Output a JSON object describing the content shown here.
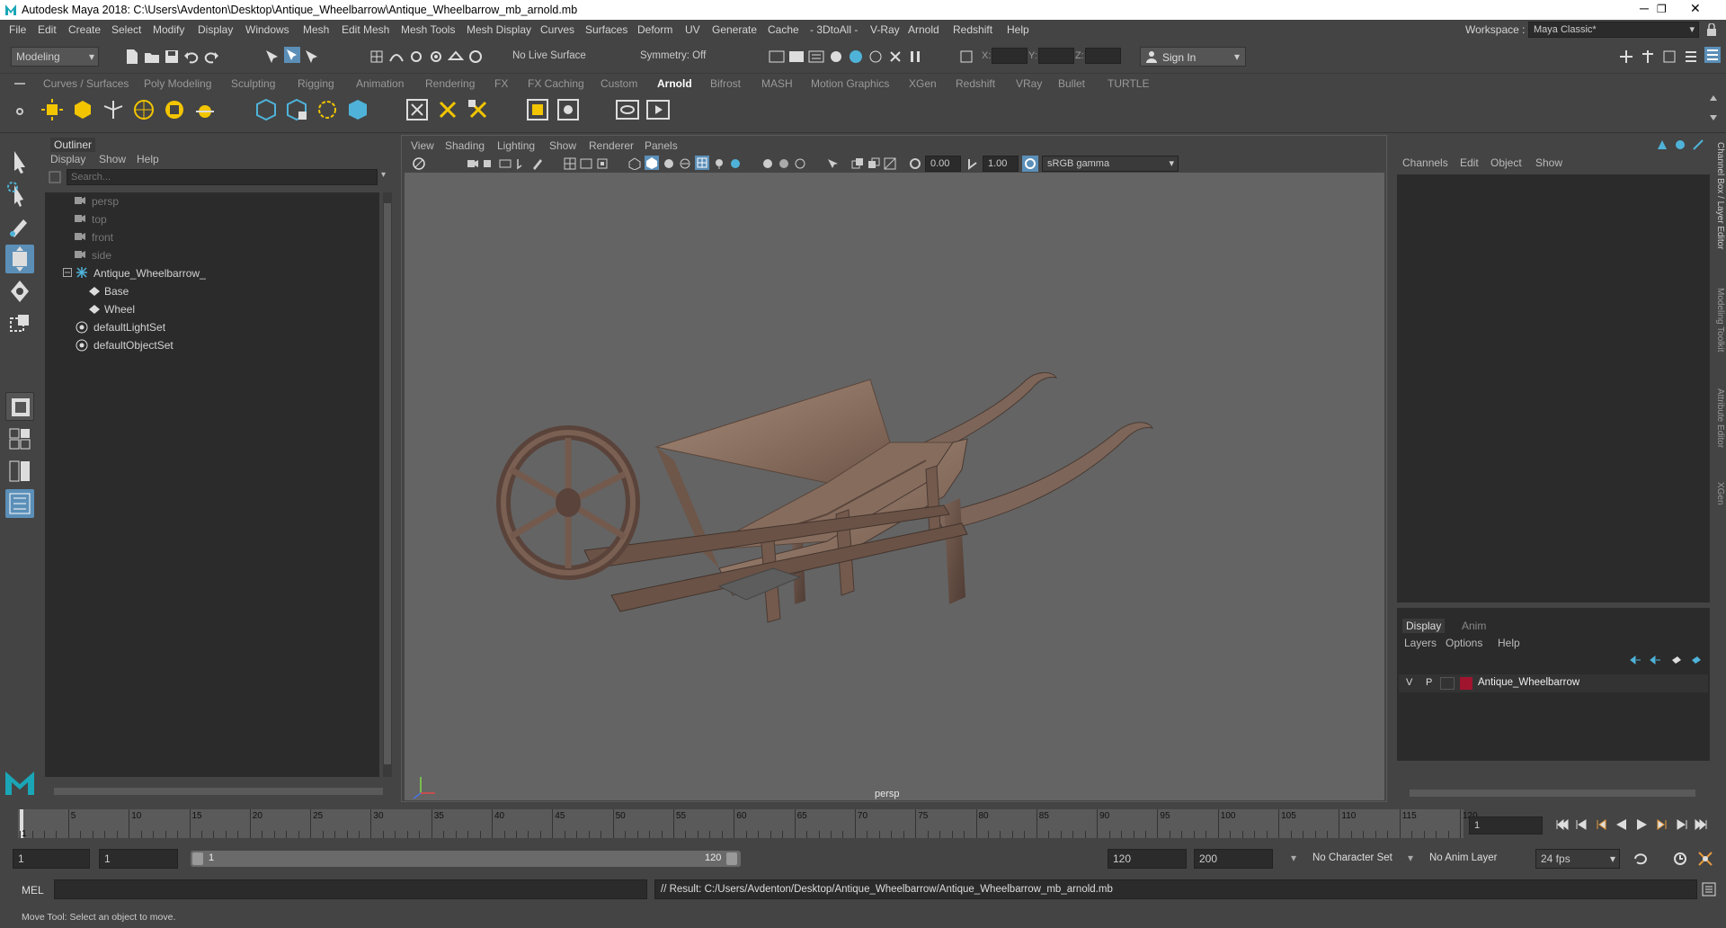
{
  "window": {
    "title": "Autodesk Maya 2018: C:\\Users\\Avdenton\\Desktop\\Antique_Wheelbarrow\\Antique_Wheelbarrow_mb_arnold.mb",
    "minimize": "─",
    "maximize": "❐",
    "close": "✕"
  },
  "menubar": {
    "items": [
      "File",
      "Edit",
      "Create",
      "Select",
      "Modify",
      "Display",
      "Windows",
      "Mesh",
      "Edit Mesh",
      "Mesh Tools",
      "Mesh Display",
      "Curves",
      "Surfaces",
      "Deform",
      "UV",
      "Generate",
      "Cache",
      "- 3DtoAll -",
      "V-Ray",
      "Arnold",
      "Redshift",
      "Help"
    ],
    "workspace_label": "Workspace :",
    "workspace_value": "Maya Classic*"
  },
  "statusline": {
    "mode": "Modeling",
    "live_surface": "No Live Surface",
    "symmetry": "Symmetry: Off",
    "x_label": "X:",
    "y_label": "Y:",
    "z_label": "Z:",
    "sign_in": "Sign In"
  },
  "shelf": {
    "tabs": [
      "Curves / Surfaces",
      "Poly Modeling",
      "Sculpting",
      "Rigging",
      "Animation",
      "Rendering",
      "FX",
      "FX Caching",
      "Custom",
      "Arnold",
      "Bifrost",
      "MASH",
      "Motion Graphics",
      "XGen",
      "Redshift",
      "VRay",
      "Bullet",
      "TURTLE"
    ],
    "active_tab": "Arnold"
  },
  "outliner": {
    "title": "Outliner",
    "menus": [
      "Display",
      "Show",
      "Help"
    ],
    "search_placeholder": "Search...",
    "items": [
      {
        "label": "persp",
        "dim": true
      },
      {
        "label": "top",
        "dim": true
      },
      {
        "label": "front",
        "dim": true
      },
      {
        "label": "side",
        "dim": true
      },
      {
        "label": "Antique_Wheelbarrow_",
        "dim": false
      },
      {
        "label": "Base",
        "dim": false
      },
      {
        "label": "Wheel",
        "dim": false
      },
      {
        "label": "defaultLightSet",
        "dim": false
      },
      {
        "label": "defaultObjectSet",
        "dim": false
      }
    ]
  },
  "viewport": {
    "menus": [
      "View",
      "Shading",
      "Lighting",
      "Show",
      "Renderer",
      "Panels"
    ],
    "exposure": "0.00",
    "gamma": "1.00",
    "color_space": "sRGB gamma",
    "camera_label": "persp"
  },
  "channelbox": {
    "menus": [
      "Channels",
      "Edit",
      "Object",
      "Show"
    ],
    "side_tabs": [
      "Channel Box / Layer Editor",
      "Modeling Toolkit",
      "Attribute Editor",
      "XGen"
    ]
  },
  "layereditor": {
    "tabs": [
      "Display",
      "Anim"
    ],
    "active_tab": "Display",
    "menus": [
      "Layers",
      "Options",
      "Help"
    ],
    "layer": {
      "v": "V",
      "p": "P",
      "name": "Antique_Wheelbarrow",
      "color": "#a0142e"
    }
  },
  "timeline": {
    "ticks": [
      "5",
      "10",
      "15",
      "20",
      "25",
      "30",
      "35",
      "40",
      "45",
      "50",
      "55",
      "60",
      "65",
      "70",
      "75",
      "80",
      "85",
      "90",
      "95",
      "100",
      "105",
      "110",
      "115",
      "120"
    ],
    "start_marker": "1",
    "current_frame": "1"
  },
  "range": {
    "start": "1",
    "playback_start": "1",
    "slider_start": "1",
    "slider_end": "120",
    "playback_end": "120",
    "end": "200",
    "character_set": "No Character Set",
    "anim_layer": "No Anim Layer",
    "fps": "24 fps"
  },
  "commandline": {
    "language": "MEL",
    "result": "// Result: C:/Users/Avdenton/Desktop/Antique_Wheelbarrow/Antique_Wheelbarrow_mb_arnold.mb"
  },
  "helpline": {
    "text": "Move Tool: Select an object to move."
  }
}
